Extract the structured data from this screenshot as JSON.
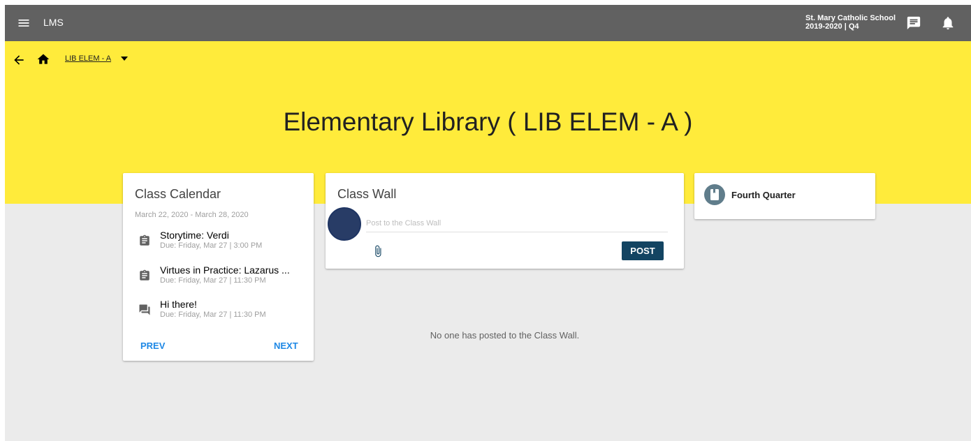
{
  "header": {
    "app_title": "LMS",
    "school_name": "St. Mary Catholic School",
    "term": "2019-2020 | Q4"
  },
  "breadcrumb": {
    "course_code": "LIB ELEM - A"
  },
  "page": {
    "title": "Elementary Library ( LIB ELEM - A )"
  },
  "calendar": {
    "title": "Class Calendar",
    "date_range": "March 22, 2020 - March 28, 2020",
    "events": [
      {
        "icon": "assignment-icon",
        "title": "Storytime: Verdi",
        "due": "Due: Friday, Mar 27 | 3:00 PM"
      },
      {
        "icon": "assignment-icon",
        "title": "Virtues in Practice: Lazarus ...",
        "due": "Due: Friday, Mar 27 | 11:30 PM"
      },
      {
        "icon": "discussion-icon",
        "title": "Hi there!",
        "due": "Due: Friday, Mar 27 | 11:30 PM"
      }
    ],
    "prev_label": "PREV",
    "next_label": "NEXT"
  },
  "wall": {
    "title": "Class Wall",
    "placeholder": "Post to the Class Wall",
    "post_label": "POST",
    "empty_message": "No one has posted to the Class Wall."
  },
  "quarter": {
    "label": "Fourth Quarter"
  },
  "colors": {
    "topbar": "#616161",
    "hero": "#ffeb3b",
    "background": "#ebebeb",
    "accent_link": "#1e88e5",
    "post_button": "#134462",
    "avatar": "#283c66",
    "quarter_icon": "#607d8b"
  }
}
